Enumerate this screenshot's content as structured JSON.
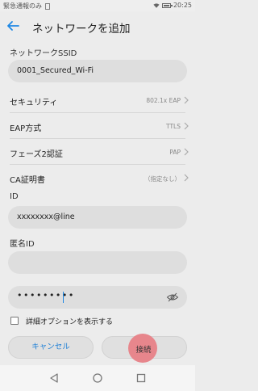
{
  "status_bar": {
    "left_text": "緊急通報のみ",
    "time": "20:25"
  },
  "app_bar": {
    "title": "ネットワークを追加"
  },
  "ssid": {
    "label": "ネットワークSSID",
    "value": "0001_Secured_Wi-Fi"
  },
  "settings": [
    {
      "label": "セキュリティ",
      "value": "802.1x EAP"
    },
    {
      "label": "EAP方式",
      "value": "TTLS"
    },
    {
      "label": "フェーズ2認証",
      "value": "PAP"
    },
    {
      "label": "CA証明書",
      "value": "（指定なし）"
    }
  ],
  "identity": {
    "label": "ID",
    "value": "xxxxxxxx@line"
  },
  "anon_identity": {
    "label": "匿名ID",
    "value": ""
  },
  "password": {
    "masked": "•••••••••"
  },
  "advanced": {
    "label": "詳細オプションを表示する",
    "checked": false
  },
  "buttons": {
    "cancel": "キャンセル",
    "connect": "接続"
  },
  "icons": {
    "back": "back-arrow-icon",
    "chevron": "chevron-right-icon",
    "eye": "eye-off-icon",
    "nav": [
      "nav-back-icon",
      "nav-home-icon",
      "nav-recent-icon"
    ]
  },
  "colors": {
    "accent": "#1e88e5",
    "pressed_ripple": "#e7868c"
  }
}
